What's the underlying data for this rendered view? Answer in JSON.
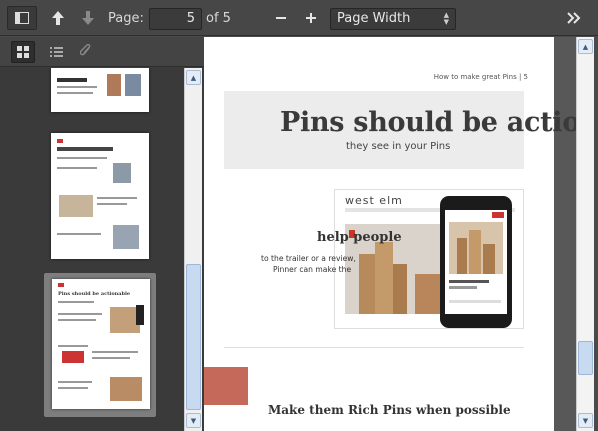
{
  "toolbar": {
    "page_label": "Page:",
    "page_value": "5",
    "page_count": "of 5",
    "zoom_value": "Page Width"
  },
  "icons": {
    "sidebar_toggle": "sidebar-toggle-icon",
    "prev": "arrow-up-icon",
    "next": "arrow-down-icon",
    "zoom_out": "minus-icon",
    "zoom_in": "plus-icon",
    "tools": "double-chevron-right-icon",
    "thumbnails": "grid-icon",
    "outline": "list-icon",
    "attachments": "paperclip-icon"
  },
  "document": {
    "header": "How to make great Pins  |  5",
    "title": "Pins should be actionable",
    "subtitle": "they see in your Pins",
    "section1": "help people",
    "body_line1": "to the trailer or a review,",
    "body_line2": "Pinner can make the",
    "section2": "Make them Rich Pins when possible",
    "product_brand": "west elm"
  },
  "thumbnail": {
    "title": "Pins should be actionable"
  }
}
